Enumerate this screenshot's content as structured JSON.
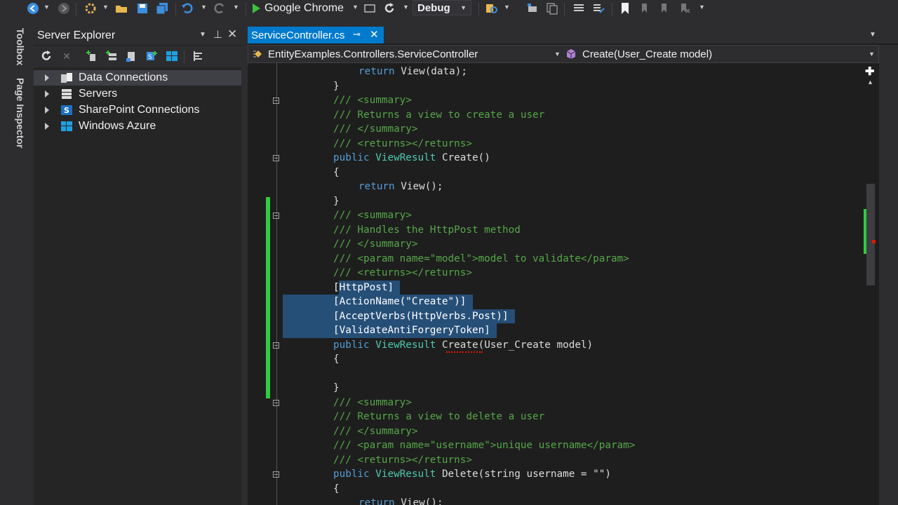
{
  "toolbar": {
    "run_target": "Google Chrome",
    "configuration": "Debug",
    "icons": [
      "back-icon",
      "forward-icon",
      "new-project-icon",
      "open-folder-icon",
      "save-icon",
      "save-all-icon",
      "undo-icon",
      "redo-icon",
      "play-icon",
      "browser-link-icon",
      "refresh-icon",
      "find-icon",
      "comment-icon",
      "bookmark-icon"
    ]
  },
  "side_tabs": [
    "Toolbox",
    "Page Inspector"
  ],
  "server_explorer": {
    "title": "Server Explorer",
    "tree": [
      {
        "label": "Data Connections",
        "icon": "data-connections-icon",
        "selected": true
      },
      {
        "label": "Servers",
        "icon": "server-icon",
        "selected": false
      },
      {
        "label": "SharePoint Connections",
        "icon": "sharepoint-icon",
        "selected": false
      },
      {
        "label": "Windows Azure",
        "icon": "windows-azure-icon",
        "selected": false
      }
    ]
  },
  "editor": {
    "tab": "ServiceController.cs",
    "nav_left": "EntityExamples.Controllers.ServiceController",
    "nav_right": "Create(User_Create model)",
    "colors": {
      "keyword": "#569cd6",
      "type": "#4ec9b0",
      "comment": "#57a64a",
      "string": "#d69d85",
      "selection": "#264f78",
      "accent": "#007acc",
      "change_bar": "#2ecc40"
    },
    "lines": [
      [
        "",
        "return ",
        "View",
        "(data);"
      ],
      [
        "",
        "}",
        "",
        ""
      ],
      [
        "",
        "/// <summary>",
        "",
        ""
      ],
      [
        "",
        "/// Returns a view to create a user",
        "",
        ""
      ],
      [
        "",
        "/// </summary>",
        "",
        ""
      ],
      [
        "",
        "/// <returns></returns>",
        "",
        ""
      ],
      [
        "",
        "public ",
        "ViewResult",
        " Create()"
      ],
      [
        "",
        "{",
        "",
        ""
      ],
      [
        "",
        "return ",
        "View",
        "();"
      ],
      [
        "",
        "}",
        "",
        ""
      ],
      [
        "",
        "/// <summary>",
        "",
        ""
      ],
      [
        "",
        "/// Handles the HttpPost method",
        "",
        ""
      ],
      [
        "",
        "/// </summary>",
        "",
        ""
      ],
      [
        "",
        "/// <param name=\"model\">model to validate</param>",
        "",
        ""
      ],
      [
        "",
        "/// <returns></returns>",
        "",
        ""
      ],
      [
        "",
        "[HttpPost]",
        "",
        ""
      ],
      [
        "",
        "[ActionName(\"Create\")]",
        "",
        ""
      ],
      [
        "",
        "[AcceptVerbs(HttpVerbs.Post)]",
        "",
        ""
      ],
      [
        "",
        "[ValidateAntiForgeryToken]",
        "",
        ""
      ],
      [
        "",
        "public ",
        "ViewResult",
        " Create(User_Create model)"
      ],
      [
        "",
        "{",
        "",
        ""
      ],
      [
        "",
        "",
        "",
        ""
      ],
      [
        "",
        "}",
        "",
        ""
      ],
      [
        "",
        "/// <summary>",
        "",
        ""
      ],
      [
        "",
        "/// Returns a view to delete a user",
        "",
        ""
      ],
      [
        "",
        "/// </summary>",
        "",
        ""
      ],
      [
        "",
        "/// <param name=\"username\">unique username</param>",
        "",
        ""
      ],
      [
        "",
        "/// <returns></returns>",
        "",
        ""
      ],
      [
        "",
        "public ",
        "ViewResult",
        " Delete(string username = \"\")"
      ],
      [
        "",
        "{",
        "",
        ""
      ],
      [
        "",
        "return ",
        "View",
        "();"
      ]
    ]
  }
}
